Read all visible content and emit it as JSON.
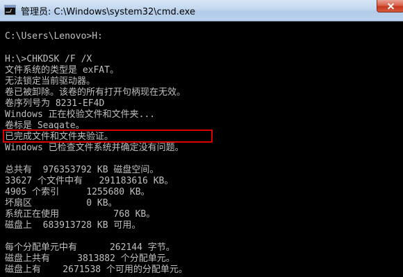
{
  "window": {
    "title": "管理员: C:\\Windows\\system32\\cmd.exe",
    "close_label": "Close"
  },
  "console": {
    "lines": [
      "C:\\Users\\Lenovo>H:",
      "H:\\>CHKDSK /F /X",
      "文件系统的类型是 exFAT。",
      "无法锁定当前驱动器。",
      "卷已被卸除。该卷的所有打开句柄现在无效。",
      "卷序列号为 8231-EF4D",
      "Windows 正在校验文件和文件夹...",
      "卷标是 Seagate。",
      "已完成文件和文件夹验证。",
      "Windows 已检查文件系统并确定没有问题。",
      "总共有  976353792 KB 磁盘空间。",
      "33627 个文件中有   291183616 KB。",
      "4905 个索引     1255680 KB。",
      "坏扇区          0 KB。",
      "系统正在使用          768 KB。",
      "磁盘上  683913728 KB 可用。",
      "每个分配单元中有      262144 字节。",
      "磁盘上共有     3813882 个分配单元。",
      "磁盘上有    2671538 个可用的分配单元。"
    ]
  },
  "colors": {
    "console_bg": "#000000",
    "console_text": "#c0c0c0",
    "highlight_border": "#e00000"
  }
}
